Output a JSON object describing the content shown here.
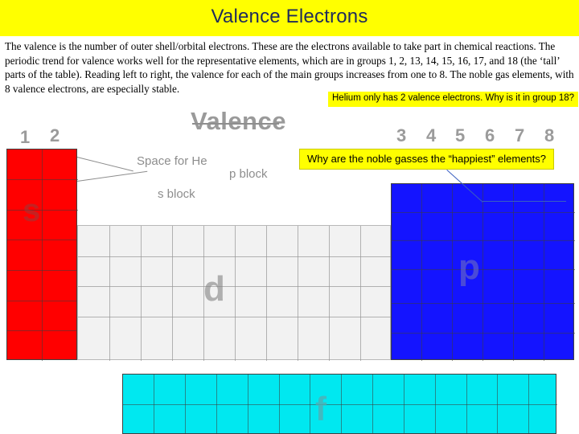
{
  "slide": {
    "title": "Valence Electrons",
    "body": "The valence is the number of outer shell/orbital electrons. These are the electrons available to take part in chemical reactions. The periodic trend for valence works well for the representative elements, which are in groups 1, 2, 13, 14, 15, 16, 17, and 18 (the ‘tall’ parts of the table). Reading left to right, the valence for each of the main groups increases from one to 8. The noble gas elements, with 8 valence electrons, are especially stable."
  },
  "callouts": {
    "helium": "Helium only has 2 valence electrons.  Why is it in group 18?",
    "noble": "Why are the noble gasses the “happiest” elements?"
  },
  "graphic": {
    "heading": "Valence",
    "group_numbers_left": [
      "1",
      "2"
    ],
    "group_numbers_right": [
      "3",
      "4",
      "5",
      "6",
      "7",
      "8"
    ],
    "labels": {
      "space_for_he": "Space for He",
      "s_block": "s block",
      "p_block": "p block"
    },
    "block_letters": {
      "s": "s",
      "p": "p",
      "d": "d",
      "f": "f"
    }
  },
  "colors": {
    "title_band": "#ffff00",
    "title_text": "#1f2b5b",
    "s_block": "#ff0000",
    "p_block": "#1414ff",
    "d_block": "#f2f2f2",
    "f_block": "#00e8f0",
    "callout_bg": "#ffff00"
  }
}
